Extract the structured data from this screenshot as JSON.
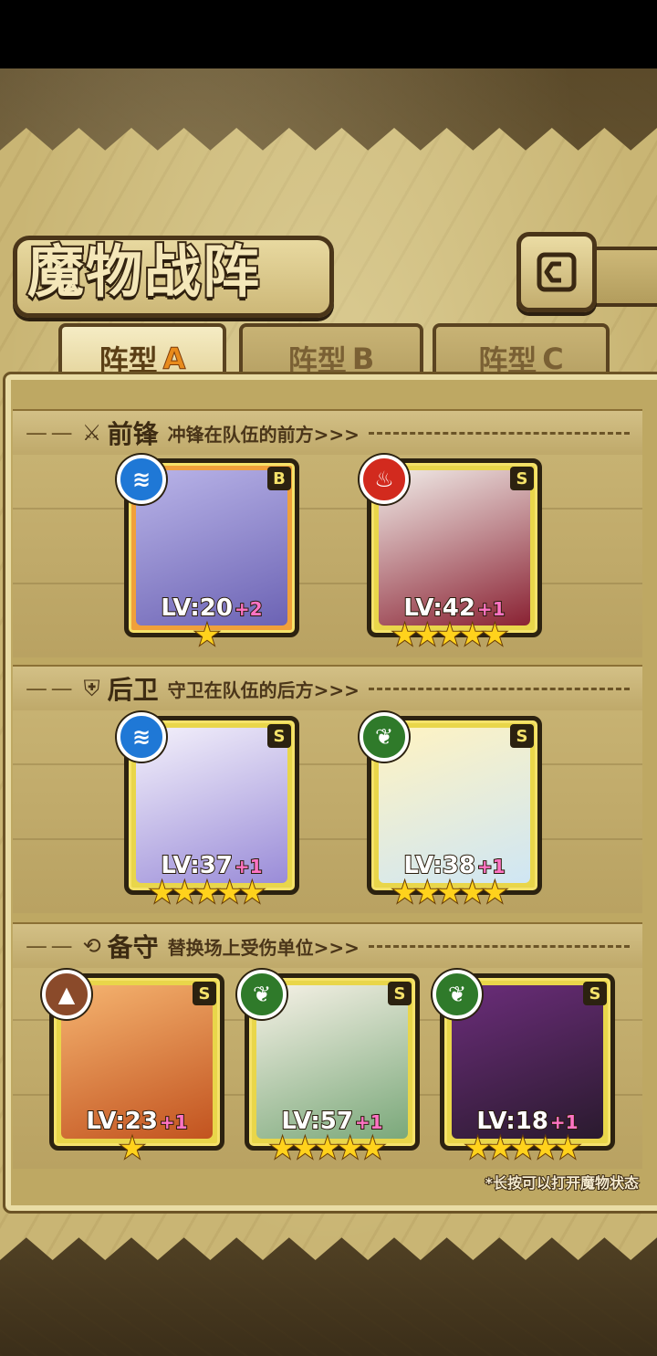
{
  "title": "魔物战阵",
  "tabs": [
    {
      "label_main": "阵型",
      "label_letter": "A",
      "active": true
    },
    {
      "label_main": "阵型",
      "label_letter": "B",
      "active": false
    },
    {
      "label_main": "阵型",
      "label_letter": "C",
      "active": false
    }
  ],
  "sections": {
    "front": {
      "title": "前锋",
      "desc": "冲锋在队伍的前方>>>",
      "icon": "sword-icon"
    },
    "back": {
      "title": "后卫",
      "desc": "守卫在队伍的后方>>>",
      "icon": "shield-icon"
    },
    "reserve": {
      "title": "备守",
      "desc": "替换场上受伤单位>>>",
      "icon": "swap-icon"
    }
  },
  "units": {
    "front": [
      {
        "level": "LV:20",
        "bonus": "+2",
        "rank": "B",
        "stars": 1,
        "element": "water",
        "frame": "orange"
      },
      {
        "level": "LV:42",
        "bonus": "+1",
        "rank": "S",
        "stars": 5,
        "element": "fire",
        "frame": "gold"
      }
    ],
    "back": [
      {
        "level": "LV:37",
        "bonus": "+1",
        "rank": "S",
        "stars": 5,
        "element": "water",
        "frame": "gold"
      },
      {
        "level": "LV:38",
        "bonus": "+1",
        "rank": "S",
        "stars": 5,
        "element": "wind",
        "frame": "gold"
      }
    ],
    "reserve": [
      {
        "level": "LV:23",
        "bonus": "+1",
        "rank": "S",
        "stars": 1,
        "element": "earth",
        "frame": "gold"
      },
      {
        "level": "LV:57",
        "bonus": "+1",
        "rank": "S",
        "stars": 5,
        "element": "wind",
        "frame": "gold"
      },
      {
        "level": "LV:18",
        "bonus": "+1",
        "rank": "S",
        "stars": 5,
        "element": "wind",
        "frame": "gold"
      }
    ]
  },
  "element_colors": {
    "water": "#1f78d6",
    "fire": "#d22a1e",
    "wind": "#2f7a2a",
    "earth": "#8a4a2a"
  },
  "hint": "*长按可以打开魔物状态"
}
